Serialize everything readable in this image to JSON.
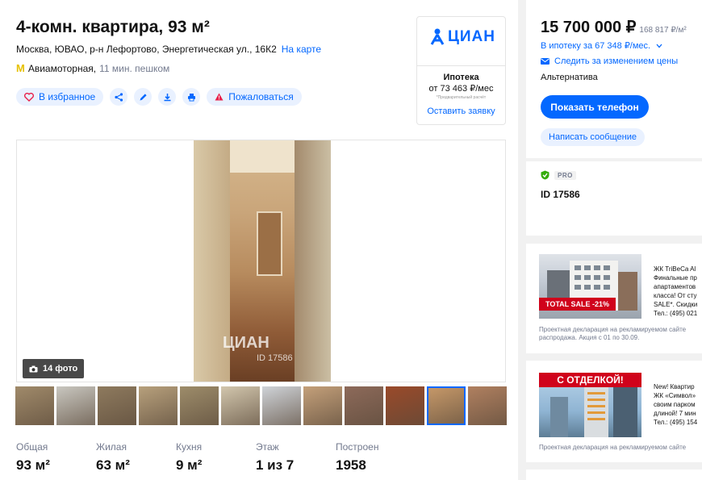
{
  "listing": {
    "title": "4-комн. квартира, 93 м²",
    "address": "Москва, ЮВАО, р-н Лефортово, Энергетическая ул., 16К2",
    "map_link": "На карте",
    "metro_icon": "М",
    "metro_station": "Авиамоторная,",
    "metro_walk": "11 мин. пешком"
  },
  "actions": {
    "favorite": "В избранное",
    "complain": "Пожаловаться",
    "icons": [
      "heart-icon",
      "share-icon",
      "pencil-icon",
      "download-icon",
      "print-icon",
      "warning-icon"
    ]
  },
  "cian_box": {
    "logo": "ЦИАН",
    "mortgage_title": "Ипотека",
    "mortgage_amount": "от 73 463 ₽/мес",
    "note": "*Предварительный расчёт",
    "leave_request": "Оставить заявку"
  },
  "gallery": {
    "watermark": "ЦИАН",
    "watermark_id": "ID 17586",
    "photo_count": "14 фото",
    "thumb_colors": [
      "#a08a6a",
      "#c9c7c0",
      "#8e7a5e",
      "#b7a07c",
      "#9d8c6a",
      "#d2c6ad",
      "#cfd3d8",
      "#c4a07a",
      "#8d6a5a",
      "#9a4a2a",
      "#c89a6a",
      "#b08060"
    ]
  },
  "stats": [
    {
      "label": "Общая",
      "value": "93 м²"
    },
    {
      "label": "Жилая",
      "value": "63 м²"
    },
    {
      "label": "Кухня",
      "value": "9 м²"
    },
    {
      "label": "Этаж",
      "value": "1 из 7"
    },
    {
      "label": "Построен",
      "value": "1958"
    }
  ],
  "price": {
    "amount": "15 700 000 ₽",
    "per_meter": "168 817 ₽/м²",
    "mortgage": "В ипотеку за 67 348 ₽/мес.",
    "follow": "Следить за изменением цены",
    "deal_type": "Альтернатива",
    "show_phone": "Показать телефон",
    "write_message": "Написать сообщение"
  },
  "agent": {
    "pro_badge": "PRO",
    "id": "ID 17586"
  },
  "ads": [
    {
      "title": "ЖК TriBeCa Al",
      "lines": [
        "Финальные пр",
        "апартаментов",
        "класса! От сту",
        "SALE*. Скидки",
        "Тел.: (495) 021"
      ],
      "badge": "TOTAL SALE -21%",
      "note_lines": [
        "Проектная декларация на рекламируемом сайте",
        "распродажа. Акция с 01 по 30.09."
      ]
    },
    {
      "title": "New! Квартир",
      "lines": [
        "ЖК «Символ»",
        "своим парком",
        "длиной! 7 мин",
        "Тел.: (495) 154"
      ],
      "badge": "С ОТДЕЛКОЙ!",
      "note_lines": [
        "Проектная декларация на рекламируемом сайте"
      ]
    }
  ]
}
